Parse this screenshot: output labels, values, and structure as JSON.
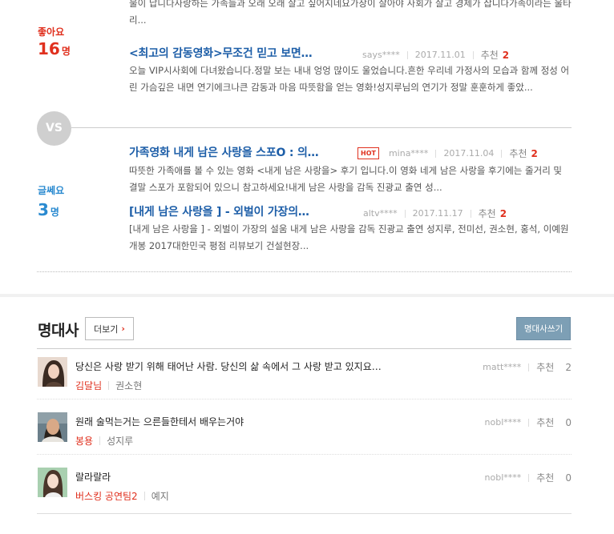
{
  "good": {
    "top_text": "물이 납니다사랑하는 가족들과 오래 오래 살고 싶어지네요가장이 살아야 사회가 살고 경제가 삽니다가족이라는 울타리...",
    "label": "좋아요",
    "count": "16",
    "unit": "명",
    "review": {
      "title": "<최고의 감동영화>무조건 믿고 보면…",
      "author": "says****",
      "date": "2017.11.01",
      "rec_label": "추천",
      "rec_count": "2",
      "summary": "오늘 VIP시사회에 다녀왔습니다.정말 보는 내내 엉엉 많이도 울었습니다.흔한 우리네 가정사의 모습과 함께 정성 어린 가슴깊은 내면 연기에크나큰 감동과 마음 따뜻함을 얻는 영화!성지루님의 연기가 정말 훈훈하게 좋았..."
    }
  },
  "vs_label": "VS",
  "soso": {
    "label": "글쎄요",
    "count": "3",
    "unit": "명",
    "reviews": [
      {
        "title": "가족영화 내게 남은 사랑을 스포O : 의…",
        "hot": "HOT",
        "author": "mina****",
        "date": "2017.11.04",
        "rec_label": "추천",
        "rec_count": "2",
        "summary": "따뜻한 가족애를 볼 수 있는 영화 <내게 남은 사랑을> 후기 입니다.이 영화 네게 남은 사랑을 후기에는 줄거리 및 결말 스포가 포함되어 있으니 참고하세요!내게 남은 사랑을 감독 진광교 출연 성..."
      },
      {
        "title": "[내게 남은 사랑을 ] - 외벌이 가장의…",
        "author": "altv****",
        "date": "2017.11.17",
        "rec_label": "추천",
        "rec_count": "2",
        "summary": "[내게 남은 사랑을 ] - 외벌이 가장의 설움 내게 남은 사랑을 감독 진광교 출연 성지루, 전미선, 권소현, 홍석, 이예원 개봉 2017대한민국 평점 리뷰보기 건설현장..."
      }
    ]
  },
  "quotes": {
    "title": "명대사",
    "more_label": "더보기",
    "write_label": "명대사쓰기",
    "items": [
      {
        "text": "당신은 사랑 받기 위해 태어난 사람. 당신의 삶 속에서 그 사랑 받고 있지요…",
        "role": "김달님",
        "actor": "권소현",
        "author": "matt****",
        "rec_label": "추천",
        "rec_count": "2"
      },
      {
        "text": "원래 술먹는거는 으른들한테서 배우는거야",
        "role": "봉용",
        "actor": "성지루",
        "author": "nobl****",
        "rec_label": "추천",
        "rec_count": "0"
      },
      {
        "text": "랄라랄라",
        "role": "버스킹 공연팀2",
        "actor": "예지",
        "author": "nobl****",
        "rec_label": "추천",
        "rec_count": "0"
      }
    ]
  },
  "colors": {
    "good": "#e0301e",
    "soso": "#2a8ad0",
    "link": "#1d5ea8",
    "write_button": "#7d9fb5"
  },
  "icons": {
    "more_arrow": "chevron-right-icon"
  }
}
